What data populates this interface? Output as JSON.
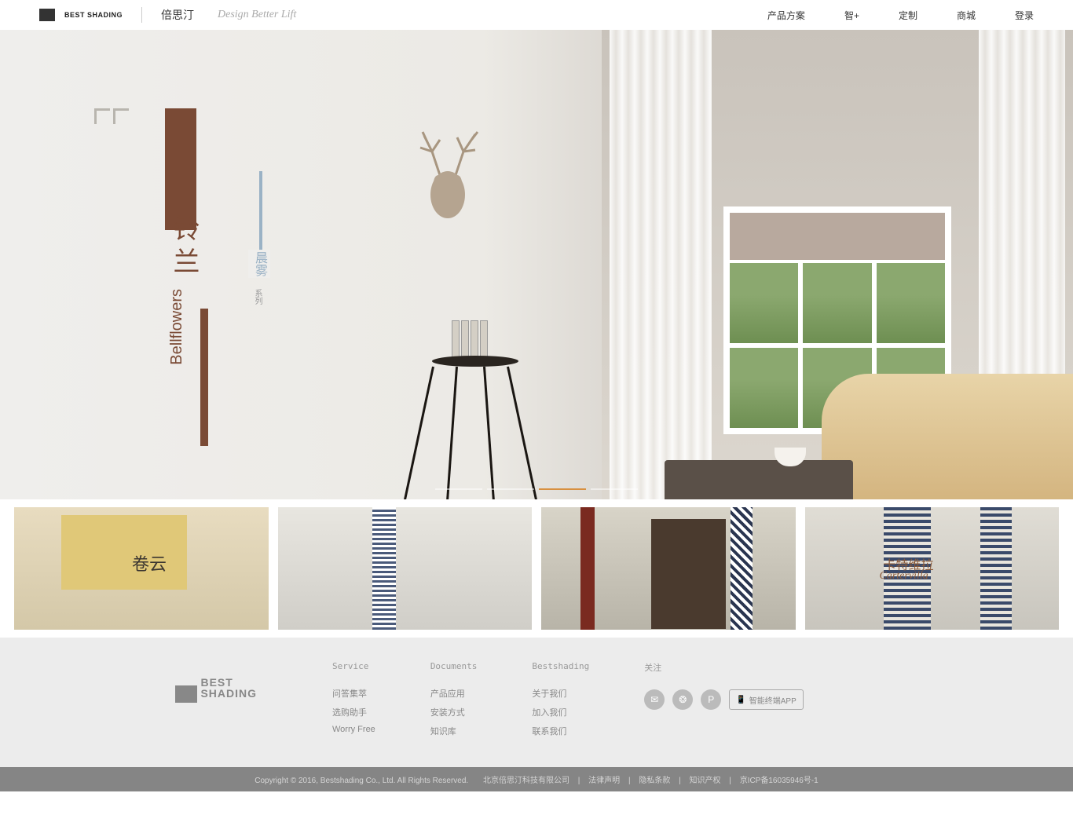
{
  "header": {
    "logo_text": "BEST SHADING",
    "brand_cn": "倍思汀",
    "tagline": "Design Better Lift",
    "nav": [
      "产品方案",
      "智+",
      "定制",
      "商城",
      "登录"
    ]
  },
  "hero": {
    "title_cn": "铃兰",
    "title_en": "Bellflowers",
    "subtitle": "晨雾",
    "subtitle_small": "系列"
  },
  "thumbs": {
    "t1_text": "卷云",
    "t4_label": "卡特维拉",
    "t4_script": "Cartervilla"
  },
  "footer": {
    "logo_text": "BEST SHADING",
    "cols": [
      {
        "h": "Service",
        "items": [
          "问答集萃",
          "选购助手",
          "Worry Free"
        ]
      },
      {
        "h": "Documents",
        "items": [
          "产品应用",
          "安装方式",
          "知识库"
        ]
      },
      {
        "h": "Bestshading",
        "items": [
          "关于我们",
          "加入我们",
          "联系我们"
        ]
      }
    ],
    "follow_h": "关注",
    "app_btn": "智能终端APP"
  },
  "footer_bar": {
    "copyright": "Copyright © 2016, Bestshading Co., Ltd. All Rights Reserved.",
    "company": "北京倍思汀科技有限公司",
    "links": [
      "法律声明",
      "隐私条款",
      "知识产权",
      "京ICP备16035946号-1"
    ]
  }
}
